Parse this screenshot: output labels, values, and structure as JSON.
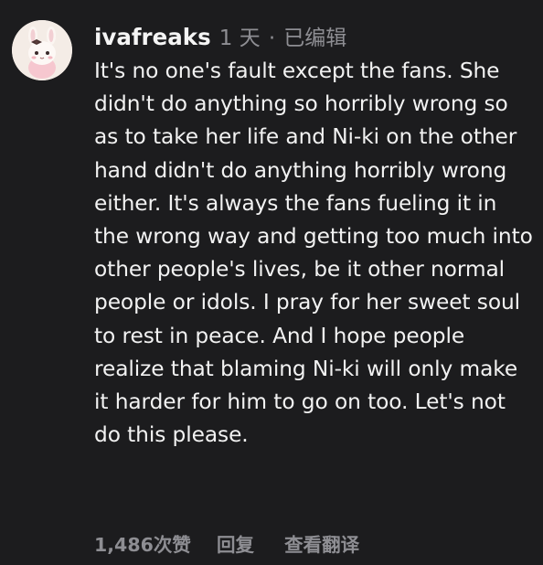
{
  "comment": {
    "username": "ivafreaks",
    "time": "1 天",
    "separator": "·",
    "edited": "已编辑",
    "text": "It's no one's fault except the fans. She didn't do anything so horribly wrong so as to take her life and Ni-ki on the other hand didn't do anything horribly wrong either. It's always the fans fueling it in the wrong way and getting too much into other people's lives, be it other normal people or idols. I pray for her sweet soul to rest in peace. And I hope people realize that blaming Ni-ki will only make it harder for him to go on too. Let's not do this please.",
    "avatar_icon": "bunny-avatar-icon"
  },
  "actions": {
    "likes": "1,486次赞",
    "reply": "回复",
    "translate": "查看翻译"
  },
  "colors": {
    "background": "#1c1c1e",
    "text": "#f2f2f2",
    "muted": "#8e8e93"
  }
}
